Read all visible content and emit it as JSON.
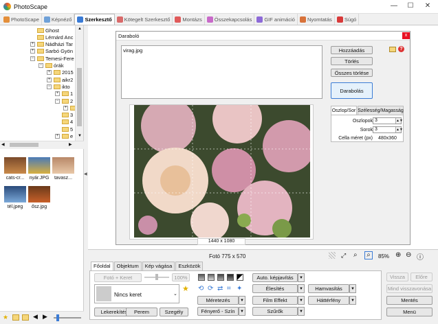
{
  "window": {
    "title": "PhotoScape",
    "min": "—",
    "max": "☐",
    "close": "✕"
  },
  "tabs": [
    {
      "label": "PhotoScape",
      "color": "#e48f3a"
    },
    {
      "label": "Képnéző",
      "color": "#6fa1d8"
    },
    {
      "label": "Szerkesztő",
      "color": "#3a7bd5"
    },
    {
      "label": "Kötegelt Szerkesztő",
      "color": "#d96a6a"
    },
    {
      "label": "Montázs",
      "color": "#e05a5a"
    },
    {
      "label": "Összekapcsolás",
      "color": "#c86ac9"
    },
    {
      "label": "GIF animáció",
      "color": "#8d6ad8"
    },
    {
      "label": "Nyomtatás",
      "color": "#d8723a"
    },
    {
      "label": "Súgó",
      "color": "#d83a3a"
    }
  ],
  "tree": [
    {
      "label": "Ghost",
      "indent": 0,
      "pm": ""
    },
    {
      "label": "Lérnárd Anc",
      "indent": 0,
      "pm": ""
    },
    {
      "label": "Nádházi Tar",
      "indent": 0,
      "pm": "+"
    },
    {
      "label": "Sarbó Gyön",
      "indent": 0,
      "pm": "+"
    },
    {
      "label": "Temesi-Fere",
      "indent": 0,
      "pm": "−"
    },
    {
      "label": "órák",
      "indent": 1,
      "pm": "−"
    },
    {
      "label": "2015",
      "indent": 2,
      "pm": "+"
    },
    {
      "label": "aikr2",
      "indent": 2,
      "pm": "+"
    },
    {
      "label": "ikto",
      "indent": 2,
      "pm": "−"
    },
    {
      "label": "1",
      "indent": 3,
      "pm": "+"
    },
    {
      "label": "2",
      "indent": 3,
      "pm": "−"
    },
    {
      "label": "",
      "indent": 4,
      "pm": "+"
    },
    {
      "label": "3",
      "indent": 3,
      "pm": ""
    },
    {
      "label": "4",
      "indent": 3,
      "pm": ""
    },
    {
      "label": "5",
      "indent": 3,
      "pm": ""
    },
    {
      "label": "e",
      "indent": 3,
      "pm": "+"
    }
  ],
  "thumbs": [
    {
      "label": "cats-cr...",
      "c1": "#c98a4a",
      "c2": "#7a4a2a"
    },
    {
      "label": "nyár.JPG",
      "c1": "#d8b040",
      "c2": "#4a7ab8"
    },
    {
      "label": "tavasz...",
      "c1": "#e8c8a8",
      "c2": "#b88868"
    },
    {
      "label": "tél.jpeg",
      "c1": "#7aa8d8",
      "c2": "#2a4a7a"
    },
    {
      "label": "ősz.jpg",
      "c1": "#c8602a",
      "c2": "#6a3a1a"
    }
  ],
  "dialog": {
    "title": "Daraboló",
    "close": "x",
    "file": "virag.jpg",
    "add": "Hozzáadás",
    "delete": "Törlés",
    "delete_all": "Összes törlése",
    "cut": "Darabolás",
    "image_size": "1440 x 1080",
    "tab_rowcol": "Oszlop/Sor",
    "tab_wh": "Szélesség/Magasság",
    "columns_label": "Oszlopok",
    "columns_value": "3",
    "rows_label": "Sorok",
    "rows_value": "3",
    "cell_label": "Cella méret (px)",
    "cell_value": "480x360"
  },
  "status": {
    "photo": "Fotó 775 x 570",
    "zoom": "85%"
  },
  "bottom_tabs": [
    "Főoldal",
    "Objektum",
    "Kép vágása",
    "Eszközök"
  ],
  "controls": {
    "photo_frame": "Fotó + Keret",
    "percent": "100%",
    "frame": "Nincs keret",
    "round": "Lekerekítés",
    "margin": "Perem",
    "corners": "Szegély",
    "auto_level": "Auto. képjavítás",
    "resize": "Méretezés",
    "brightness": "Fényerő - Szín",
    "sharpen": "Élesítés",
    "film": "Film Effekt",
    "filters": "Szűrők",
    "washed": "Hamvasítás",
    "backlight": "Háttérfény",
    "undo": "Vissza",
    "redo": "Előre",
    "undo_all": "Mind visszavonása",
    "save": "Mentés",
    "menu": "Menü"
  }
}
